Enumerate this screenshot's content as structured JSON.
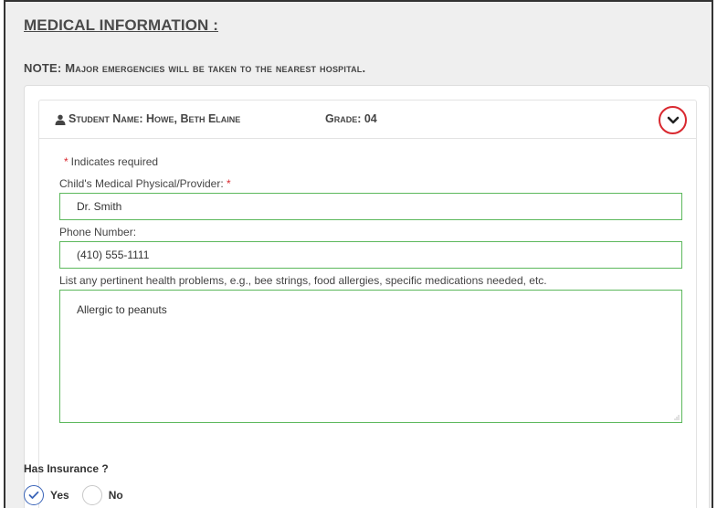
{
  "section": {
    "title": "MEDICAL INFORMATION :",
    "note": "NOTE: Major emergencies will be taken to the nearest hospital."
  },
  "student": {
    "name_label": "Student Name: Howe, Beth Elaine",
    "grade_label": "Grade: 04",
    "user_icon": "user-icon",
    "toggle_icon": "chevron-down-icon"
  },
  "form": {
    "required_star": "*",
    "required_note": "Indicates required",
    "provider": {
      "label": "Child's Medical Physical/Provider:",
      "required_star": "*",
      "value": "Dr. Smith"
    },
    "phone": {
      "label": "Phone Number:",
      "value": "(410) 555-1111"
    },
    "health": {
      "label": "List any pertinent health problems, e.g., bee strings, food allergies, specific medications needed, etc.",
      "value": "Allergic to peanuts"
    }
  },
  "insurance": {
    "label": "Has Insurance ?",
    "options": [
      {
        "label": "Yes",
        "checked": true
      },
      {
        "label": "No",
        "checked": false
      }
    ]
  },
  "colors": {
    "required": "#d9282f",
    "input_border": "#5cb85c",
    "radio_checked": "#3a64b8"
  }
}
